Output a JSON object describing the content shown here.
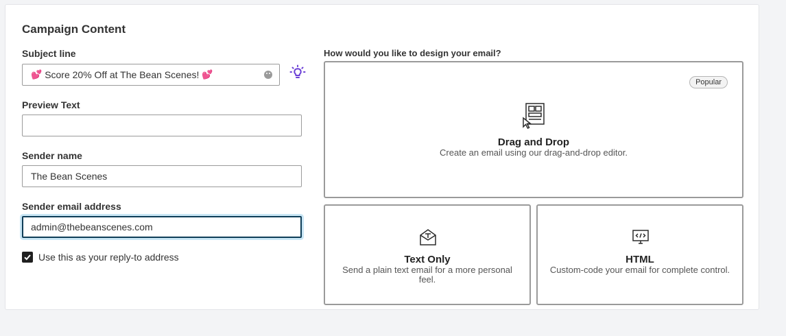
{
  "card": {
    "title": "Campaign Content"
  },
  "subject": {
    "label": "Subject line",
    "emoji_left": "💕",
    "text": "Score 20% Off at The Bean Scenes!",
    "emoji_right": "💕"
  },
  "preview": {
    "label": "Preview Text",
    "value": ""
  },
  "sender_name": {
    "label": "Sender name",
    "value": "The Bean Scenes"
  },
  "sender_email": {
    "label": "Sender email address",
    "value": "admin@thebeanscenes.com"
  },
  "reply_to": {
    "label": "Use this as your reply-to address",
    "checked": true
  },
  "design": {
    "question": "How would you like to design your email?",
    "options": [
      {
        "title": "Drag and Drop",
        "desc": "Create an email using our drag-and-drop editor.",
        "badge": "Popular",
        "icon": "drag-drop-icon"
      },
      {
        "title": "Text Only",
        "desc": "Send a plain text email for a more personal feel.",
        "icon": "text-envelope-icon"
      },
      {
        "title": "HTML",
        "desc": "Custom-code your email for complete control.",
        "icon": "code-monitor-icon"
      }
    ]
  },
  "colors": {
    "accent_purple": "#6b3fd6",
    "focus_border": "#0e3d57",
    "focus_glow": "#c9e6f5"
  }
}
